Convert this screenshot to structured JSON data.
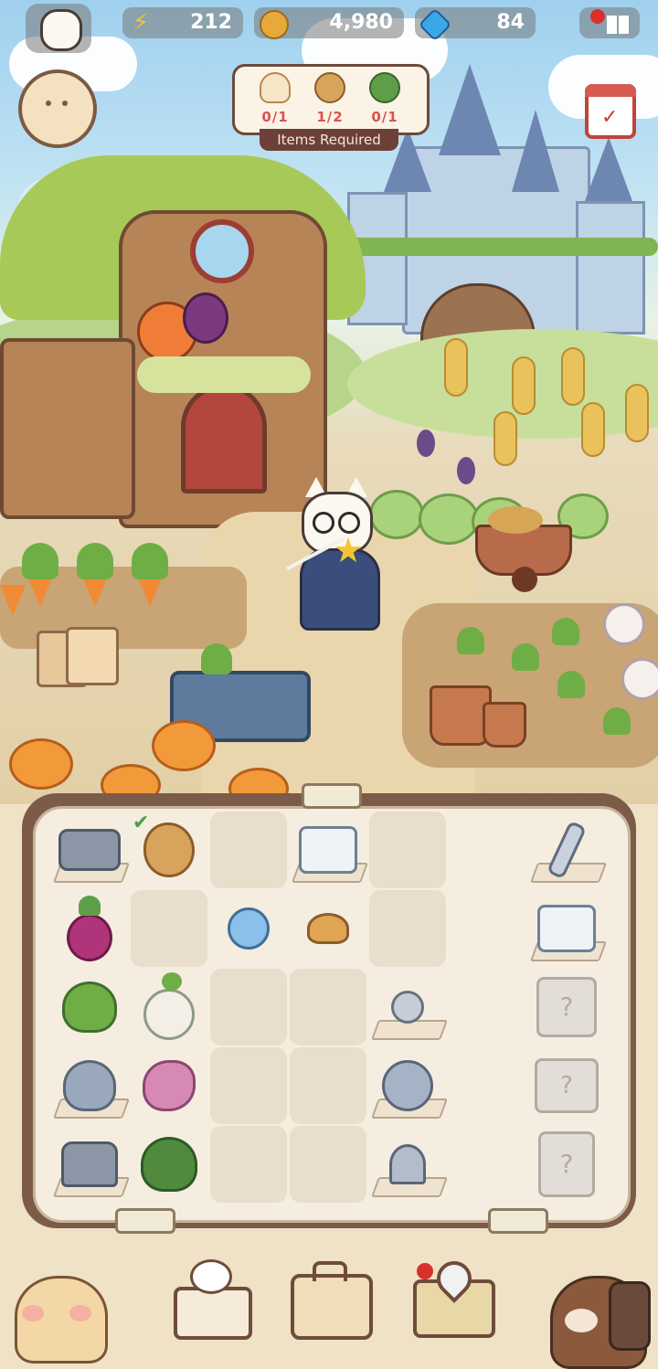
{
  "hud": {
    "energy": "212",
    "coins": "4,980",
    "gems": "84"
  },
  "required_items": {
    "label": "Items Required",
    "items": [
      {
        "icon": "radish-icon",
        "count": "0/1"
      },
      {
        "icon": "potato-icon",
        "count": "1/2"
      },
      {
        "icon": "broccoli-icon",
        "count": "0/1"
      }
    ]
  },
  "board": {
    "rows": [
      [
        "rope-sack-gray",
        "potato-checked",
        "empty",
        "ice-cube-gray",
        "empty",
        "dropper-gray"
      ],
      [
        "beet",
        "empty",
        "forget-me-not",
        "bread-roll",
        "empty",
        "ice-cube-gray"
      ],
      [
        "sapling",
        "turnip",
        "empty",
        "empty",
        "seedling-gray",
        "mystery-bag"
      ],
      [
        "sapling-gray",
        "pink-herb",
        "empty",
        "empty",
        "clover-gray",
        "mystery-box"
      ],
      [
        "watering-pot-gray",
        "kale",
        "empty",
        "empty",
        "sprout-gray",
        "mystery-gift"
      ]
    ]
  },
  "colors": {
    "board_frame": "#7c5b48",
    "board_bg": "#f5ede0",
    "label_bg": "#6c4038",
    "count_red": "#d9534f",
    "count_green": "#5aa05a"
  },
  "nav": {
    "items": [
      "hamster-character-icon",
      "recipe-book-icon",
      "suitcase-icon",
      "map-icon",
      "bear-character-icon"
    ]
  }
}
